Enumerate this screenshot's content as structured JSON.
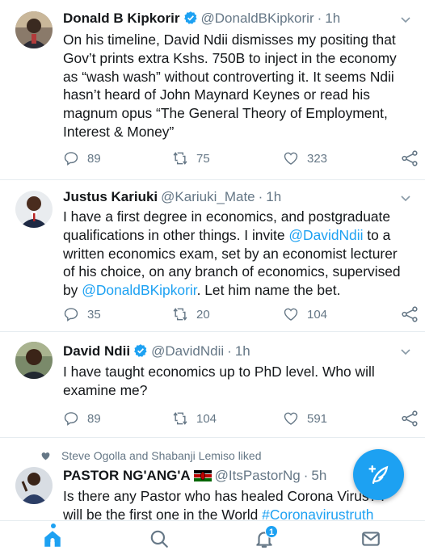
{
  "tweets": [
    {
      "name": "Donald B Kipkorir",
      "verified": true,
      "handle": "@DonaldBKipkorir",
      "sep": "·",
      "time": "1h",
      "text_lines": [
        "On his timeline, David Ndii dismisses my positing that",
        "Gov’t prints extra Kshs. 750B to inject in the economy",
        "as “wash wash” without controverting it. It seems Ndii",
        "hasn’t heard of John Maynard Keynes or read his",
        "magnum opus “The General Theory of Employment,",
        "Interest & Money”"
      ],
      "replies": "89",
      "retweets": "75",
      "likes": "323"
    },
    {
      "name": "Justus Kariuki",
      "verified": false,
      "handle": "@Kariuki_Mate",
      "sep": "·",
      "time": "1h",
      "text": {
        "l1": "I have a first degree in economics, and postgraduate",
        "l2": "qualifications in other things. I invite ",
        "l2_mention": "@DavidNdii",
        "l2_end": " to a",
        "l3": "written economics exam, set by an economist lecturer",
        "l4": "of his choice, on any branch of economics, supervised",
        "l5_pre": "by ",
        "l5_mention": "@DonaldBKipkorir",
        "l5_end": ". Let him name the bet."
      },
      "replies": "35",
      "retweets": "20",
      "likes": "104"
    },
    {
      "name": "David Ndii",
      "verified": true,
      "handle": "@DavidNdii",
      "sep": "·",
      "time": "1h",
      "text_lines": [
        "I have taught economics up to PhD level. Who will",
        "examine me?"
      ],
      "replies": "89",
      "retweets": "104",
      "likes": "591"
    },
    {
      "social_context": "Steve Ogolla and Shabanji Lemiso liked",
      "name": "PASTOR NG'ANG'A",
      "handle": "@ItsPastorNg",
      "sep": "·",
      "time": "5h",
      "text": {
        "l1": "Is there any Pastor who has healed Corona Virus? I",
        "l2_pre": "will be the first one in the World ",
        "l2_hashtag": "#Coronavirustruth"
      }
    }
  ],
  "nav": {
    "notifications_badge": "1",
    "icons": [
      "home-icon",
      "search-icon",
      "notifications-icon",
      "messages-icon"
    ]
  },
  "colors": {
    "accent": "#1da1f2",
    "text": "#14171a",
    "muted": "#657786"
  }
}
